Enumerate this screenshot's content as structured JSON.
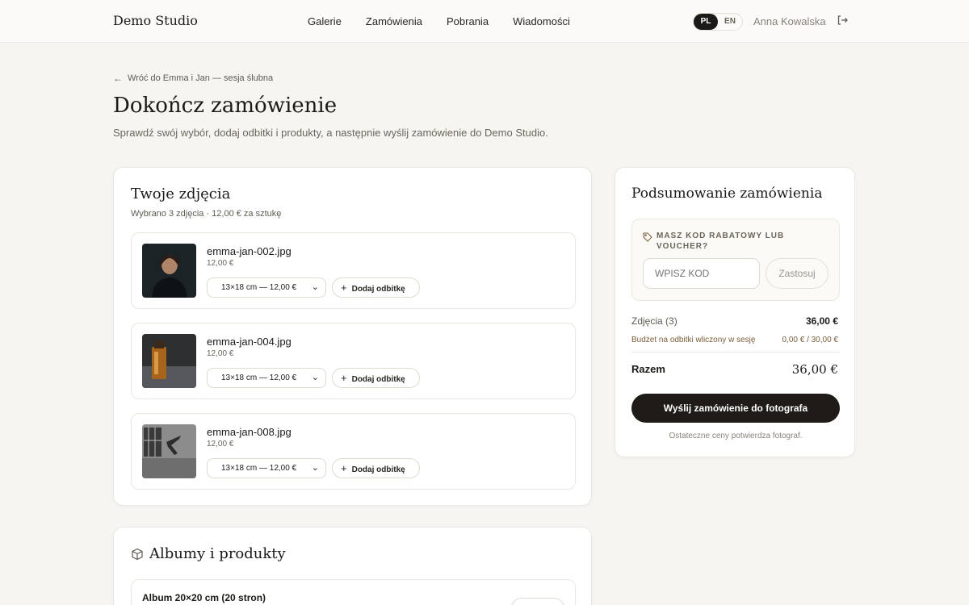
{
  "header": {
    "brand": "Demo Studio",
    "nav": [
      "Galerie",
      "Zamówienia",
      "Pobrania",
      "Wiadomości"
    ],
    "lang_active": "PL",
    "lang_other": "EN",
    "user": "Anna Kowalska"
  },
  "page": {
    "back_label": "Wróć do Emma i Jan — sesja ślubna",
    "title": "Dokończ zamówienie",
    "subtitle": "Sprawdź swój wybór, dodaj odbitki i produkty, a następnie wyślij zamówienie do Demo Studio."
  },
  "photos": {
    "title": "Twoje zdjęcia",
    "subtitle": "Wybrano 3 zdjęcia · 12,00 € za sztukę",
    "items": [
      {
        "file": "emma-jan-002.jpg",
        "price": "12,00 €",
        "size": "13×18 cm — 12,00 €",
        "add_label": "Dodaj odbitkę"
      },
      {
        "file": "emma-jan-004.jpg",
        "price": "12,00 €",
        "size": "13×18 cm — 12,00 €",
        "add_label": "Dodaj odbitkę"
      },
      {
        "file": "emma-jan-008.jpg",
        "price": "12,00 €",
        "size": "13×18 cm — 12,00 €",
        "add_label": "Dodaj odbitkę"
      }
    ]
  },
  "albums": {
    "title": "Albumy i produkty",
    "items": [
      {
        "name": "Album 20×20 cm (20 stron)"
      }
    ]
  },
  "summary": {
    "title": "Podsumowanie zamówienia",
    "voucher_label": "MASZ KOD RABATOWY LUB VOUCHER?",
    "voucher_placeholder": "WPISZ KOD",
    "apply_label": "Zastosuj",
    "photos_label": "Zdjęcia (3)",
    "photos_value": "36,00 €",
    "budget_label": "Budżet na odbitki wliczony w sesję",
    "budget_value": "0,00 € / 30,00 €",
    "total_label": "Razem",
    "total_value": "36,00 €",
    "send_label": "Wyślij zamówienie do fotografa",
    "note": "Ostateczne ceny potwierdza fotograf."
  }
}
